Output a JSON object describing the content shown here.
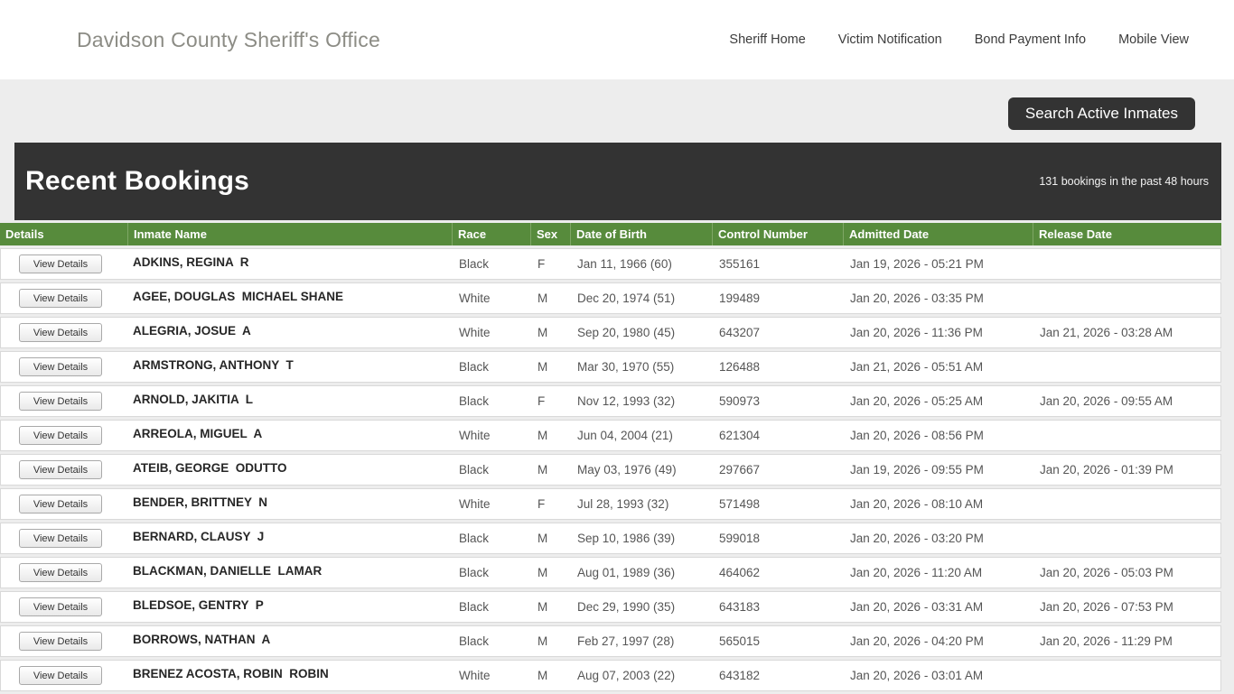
{
  "header": {
    "title": "Davidson County Sheriff's Office",
    "nav": [
      {
        "label": "Sheriff Home"
      },
      {
        "label": "Victim Notification"
      },
      {
        "label": "Bond Payment Info"
      },
      {
        "label": "Mobile View"
      }
    ]
  },
  "search_button_label": "Search Active Inmates",
  "panel": {
    "title": "Recent Bookings",
    "count_text": "131 bookings in the past 48 hours"
  },
  "table": {
    "columns": [
      "Details",
      "Inmate Name",
      "Race",
      "Sex",
      "Date of Birth",
      "Control Number",
      "Admitted Date",
      "Release Date"
    ],
    "view_details_label": "View Details",
    "rows": [
      {
        "name": "ADKINS, REGINA  R",
        "race": "Black",
        "sex": "F",
        "dob": "Jan 11, 1966 (60)",
        "control": "355161",
        "admitted": "Jan 19, 2026 - 05:21 PM",
        "released": ""
      },
      {
        "name": "AGEE, DOUGLAS  MICHAEL SHANE",
        "race": "White",
        "sex": "M",
        "dob": "Dec 20, 1974 (51)",
        "control": "199489",
        "admitted": "Jan 20, 2026 - 03:35 PM",
        "released": ""
      },
      {
        "name": "ALEGRIA, JOSUE  A",
        "race": "White",
        "sex": "M",
        "dob": "Sep 20, 1980 (45)",
        "control": "643207",
        "admitted": "Jan 20, 2026 - 11:36 PM",
        "released": "Jan 21, 2026 - 03:28 AM"
      },
      {
        "name": "ARMSTRONG, ANTHONY  T",
        "race": "Black",
        "sex": "M",
        "dob": "Mar 30, 1970 (55)",
        "control": "126488",
        "admitted": "Jan 21, 2026 - 05:51 AM",
        "released": ""
      },
      {
        "name": "ARNOLD, JAKITIA  L",
        "race": "Black",
        "sex": "F",
        "dob": "Nov 12, 1993 (32)",
        "control": "590973",
        "admitted": "Jan 20, 2026 - 05:25 AM",
        "released": "Jan 20, 2026 - 09:55 AM"
      },
      {
        "name": "ARREOLA, MIGUEL  A",
        "race": "White",
        "sex": "M",
        "dob": "Jun 04, 2004 (21)",
        "control": "621304",
        "admitted": "Jan 20, 2026 - 08:56 PM",
        "released": ""
      },
      {
        "name": "ATEIB, GEORGE  ODUTTO",
        "race": "Black",
        "sex": "M",
        "dob": "May 03, 1976 (49)",
        "control": "297667",
        "admitted": "Jan 19, 2026 - 09:55 PM",
        "released": "Jan 20, 2026 - 01:39 PM"
      },
      {
        "name": "BENDER, BRITTNEY  N",
        "race": "White",
        "sex": "F",
        "dob": "Jul 28, 1993 (32)",
        "control": "571498",
        "admitted": "Jan 20, 2026 - 08:10 AM",
        "released": ""
      },
      {
        "name": "BERNARD, CLAUSY  J",
        "race": "Black",
        "sex": "M",
        "dob": "Sep 10, 1986 (39)",
        "control": "599018",
        "admitted": "Jan 20, 2026 - 03:20 PM",
        "released": ""
      },
      {
        "name": "BLACKMAN, DANIELLE  LAMAR",
        "race": "Black",
        "sex": "M",
        "dob": "Aug 01, 1989 (36)",
        "control": "464062",
        "admitted": "Jan 20, 2026 - 11:20 AM",
        "released": "Jan 20, 2026 - 05:03 PM"
      },
      {
        "name": "BLEDSOE, GENTRY  P",
        "race": "Black",
        "sex": "M",
        "dob": "Dec 29, 1990 (35)",
        "control": "643183",
        "admitted": "Jan 20, 2026 - 03:31 AM",
        "released": "Jan 20, 2026 - 07:53 PM"
      },
      {
        "name": "BORROWS, NATHAN  A",
        "race": "Black",
        "sex": "M",
        "dob": "Feb 27, 1997 (28)",
        "control": "565015",
        "admitted": "Jan 20, 2026 - 04:20 PM",
        "released": "Jan 20, 2026 - 11:29 PM"
      },
      {
        "name": "BRENEZ ACOSTA, ROBIN  ROBIN",
        "race": "White",
        "sex": "M",
        "dob": "Aug 07, 2003 (22)",
        "control": "643182",
        "admitted": "Jan 20, 2026 - 03:01 AM",
        "released": ""
      }
    ]
  },
  "colors": {
    "accent_green": "#578b3c",
    "dark_bar": "#333333",
    "page_background": "#ededed"
  }
}
